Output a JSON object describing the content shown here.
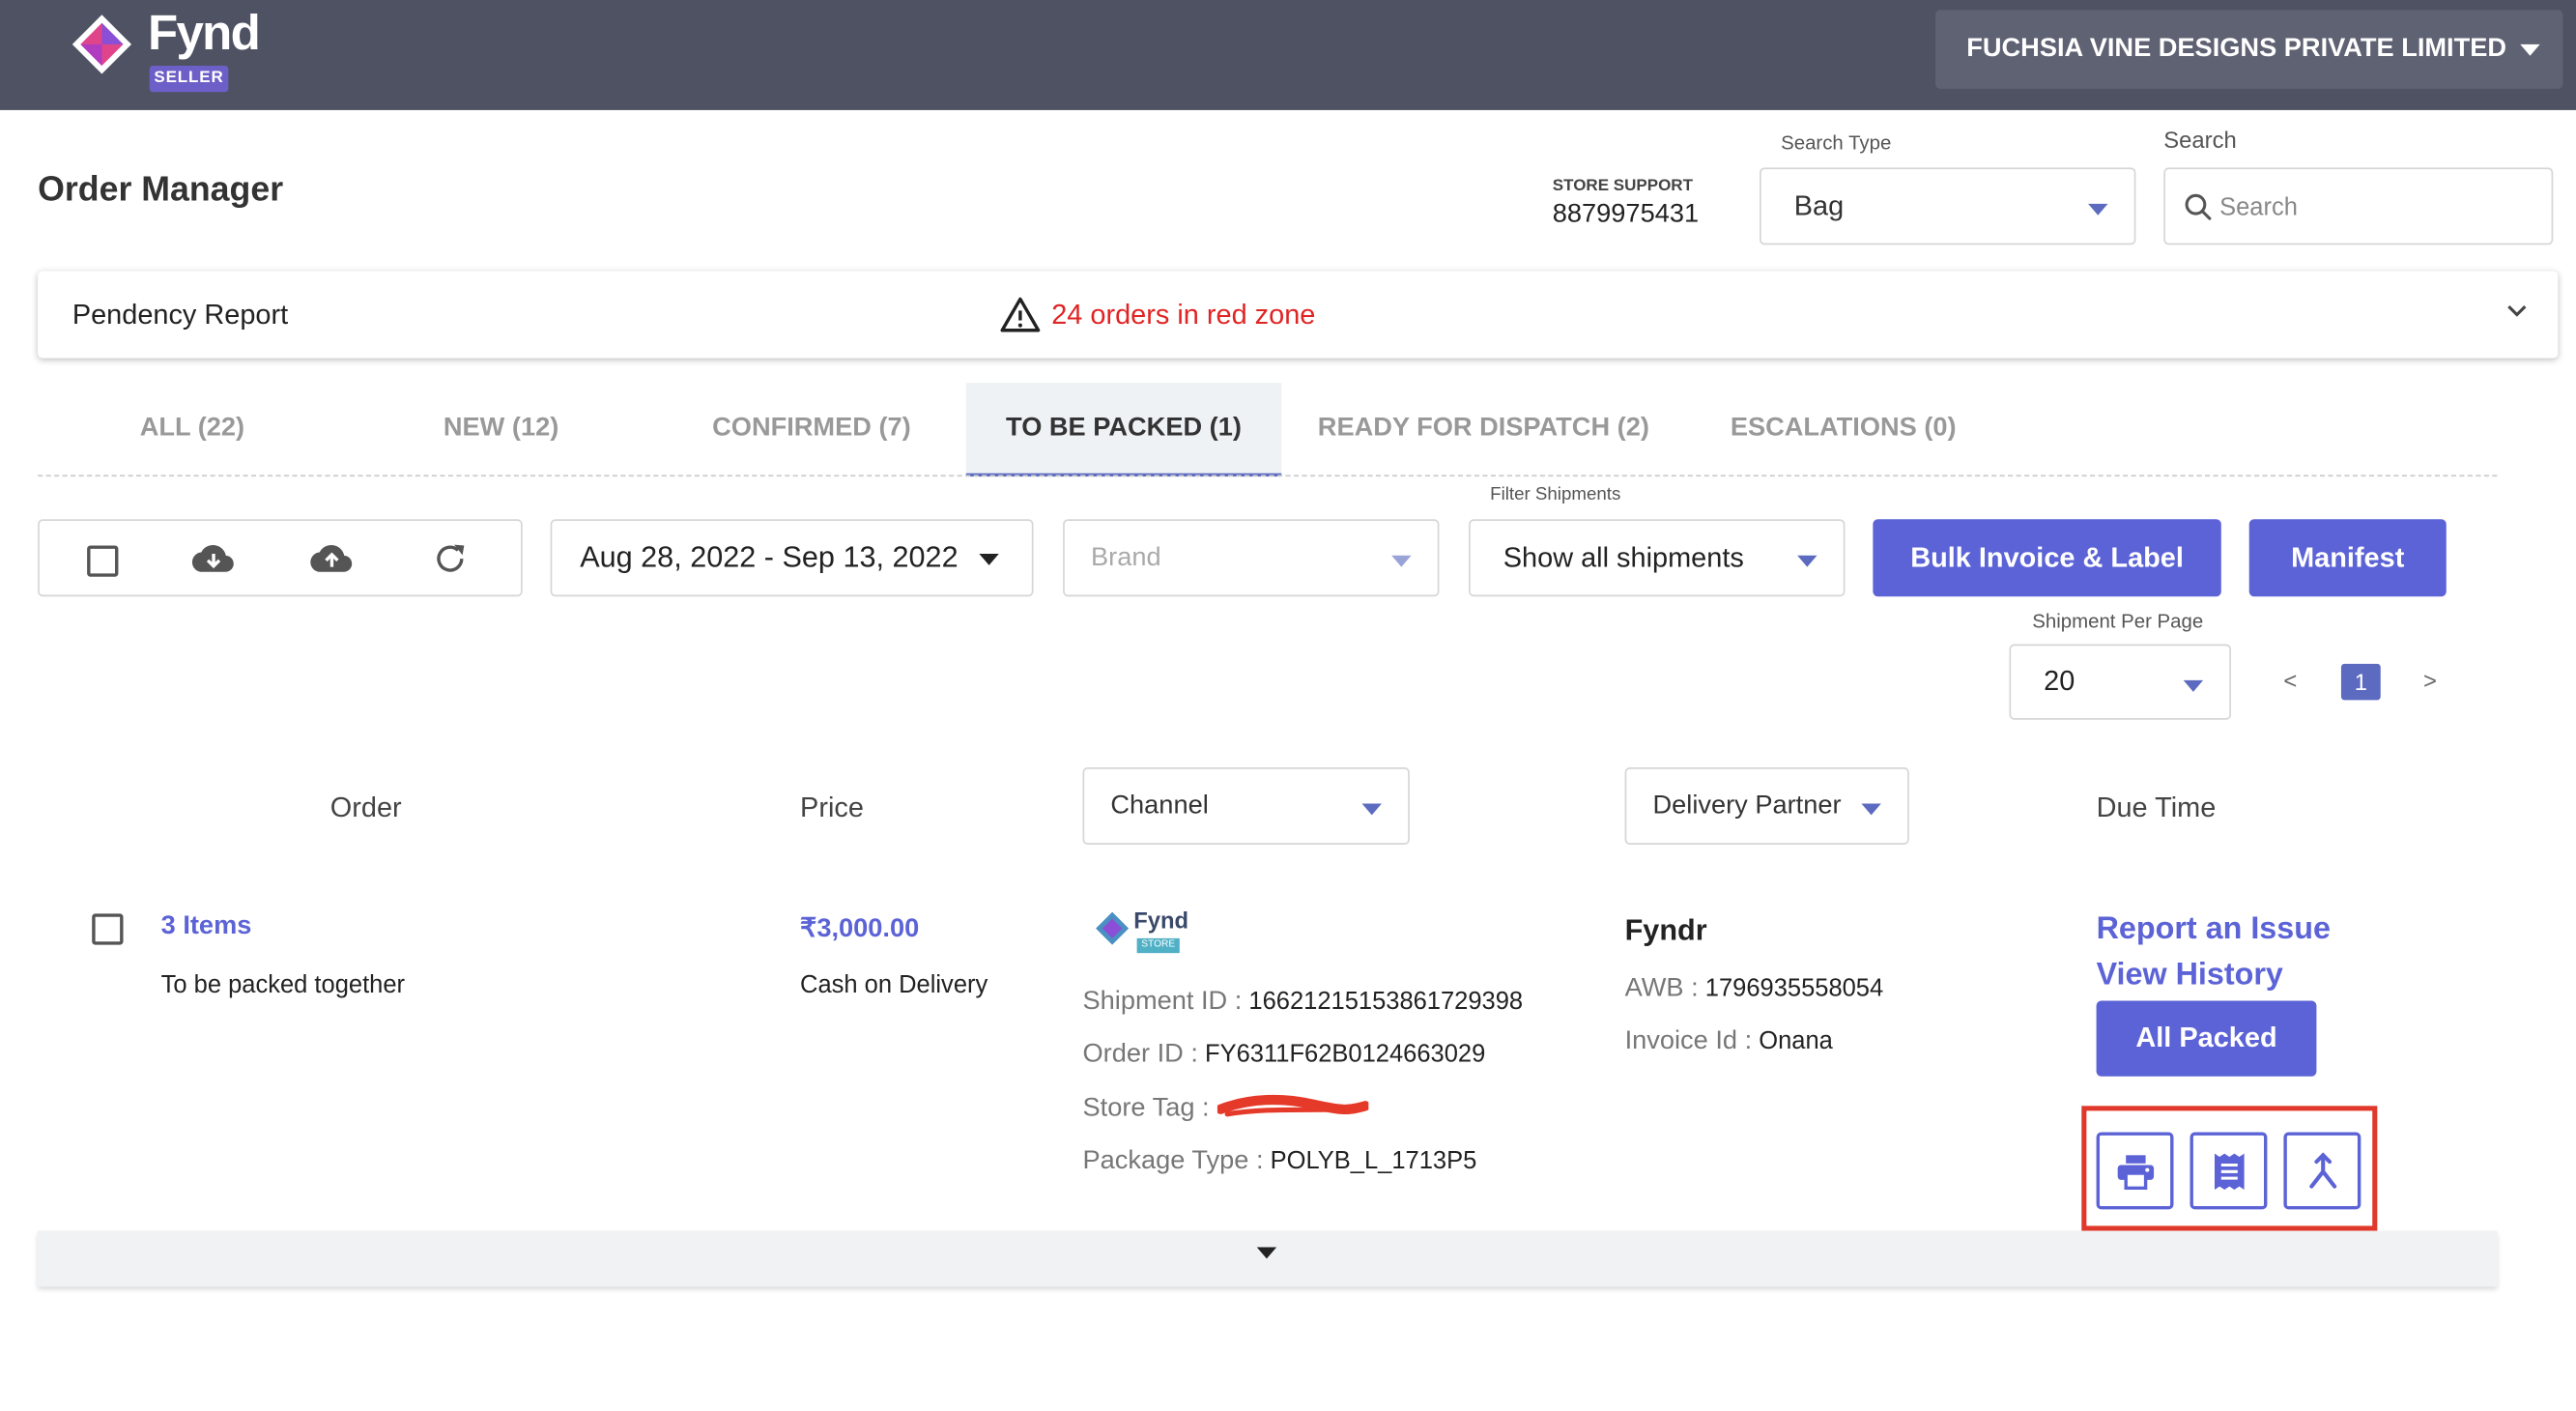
{
  "brand": {
    "name": "Fynd",
    "badge": "SELLER"
  },
  "header": {
    "company": "FUCHSIA VINE DESIGNS PRIVATE LIMITED"
  },
  "page": {
    "title": "Order Manager",
    "store_support_label": "STORE SUPPORT",
    "store_support_number": "8879975431",
    "search_type_label": "Search Type",
    "search_type_value": "Bag",
    "search_label": "Search",
    "search_placeholder": "Search"
  },
  "pendency": {
    "title": "Pendency Report",
    "alert": "24 orders in red zone"
  },
  "tabs": [
    {
      "label": "ALL (22)"
    },
    {
      "label": "NEW (12)"
    },
    {
      "label": "CONFIRMED (7)"
    },
    {
      "label": "TO BE PACKED (1)"
    },
    {
      "label": "READY FOR DISPATCH (2)"
    },
    {
      "label": "ESCALATIONS (0)"
    }
  ],
  "active_tab": "TO BE PACKED (1)",
  "toolbar": {
    "date_range": "Aug 28, 2022 - Sep 13, 2022",
    "brand_placeholder": "Brand",
    "filter_label": "Filter Shipments",
    "filter_value": "Show all shipments",
    "bulk_button": "Bulk Invoice & Label",
    "manifest_button": "Manifest",
    "per_page_label": "Shipment Per Page",
    "per_page_value": "20",
    "pager_prev": "<",
    "pager_current": "1",
    "pager_next": ">"
  },
  "table": {
    "col_order": "Order",
    "col_price": "Price",
    "col_channel": "Channel",
    "col_delivery": "Delivery Partner",
    "col_due": "Due Time"
  },
  "row": {
    "items_link": "3 Items",
    "pack_note": "To be packed together",
    "price": "₹3,000.00",
    "payment": "Cash on Delivery",
    "channel_logo_text": "Fynd",
    "channel_logo_badge": "STORE",
    "shipment_id_label": "Shipment ID :",
    "shipment_id": "16621215153861729398",
    "order_id_label": "Order ID :",
    "order_id": "FY6311F62B0124663029",
    "store_tag_label": "Store Tag :",
    "package_type_label": "Package Type :",
    "package_type": "POLYB_L_1713P5",
    "partner": "Fyndr",
    "awb_label": "AWB :",
    "awb": "1796935558054",
    "invoice_label": "Invoice Id :",
    "invoice": "Onana",
    "report_link": "Report an Issue",
    "history_link": "View History",
    "all_packed_button": "All Packed"
  },
  "icons": [
    "printer-icon",
    "invoice-icon",
    "split-icon",
    "cloud-download-icon",
    "cloud-upload-icon",
    "refresh-icon",
    "warning-icon",
    "search-icon"
  ],
  "colors": {
    "accent": "#5c63d6",
    "topbar": "#4f5262",
    "alert": "#e02424",
    "highlight": "#e0392b"
  }
}
